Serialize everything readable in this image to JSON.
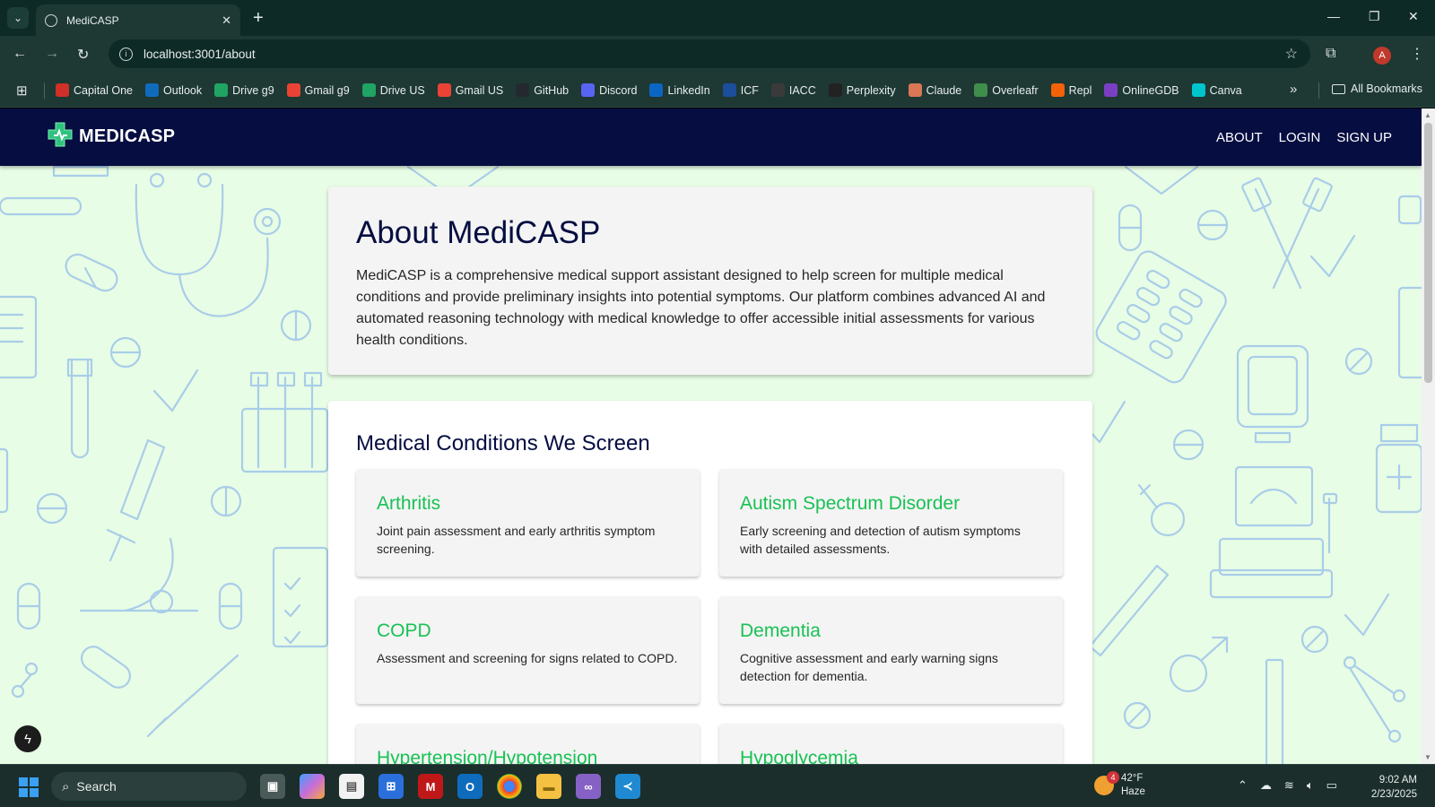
{
  "browser": {
    "tab_title": "MediCASP",
    "url": "localhost:3001/about",
    "profile_initial": "A",
    "bookmarks": [
      {
        "label": "Capital One",
        "color": "#d03027"
      },
      {
        "label": "Outlook",
        "color": "#0f6cbd"
      },
      {
        "label": "Drive g9",
        "color": "#1fa463"
      },
      {
        "label": "Gmail g9",
        "color": "#ea4335"
      },
      {
        "label": "Drive US",
        "color": "#1fa463"
      },
      {
        "label": "Gmail US",
        "color": "#ea4335"
      },
      {
        "label": "GitHub",
        "color": "#24292f"
      },
      {
        "label": "Discord",
        "color": "#5865f2"
      },
      {
        "label": "LinkedIn",
        "color": "#0a66c2"
      },
      {
        "label": "ICF",
        "color": "#1b4f9c"
      },
      {
        "label": "IACC",
        "color": "#3a3a3a"
      },
      {
        "label": "Perplexity",
        "color": "#222222"
      },
      {
        "label": "Claude",
        "color": "#d97757"
      },
      {
        "label": "Overleafr",
        "color": "#3f8f4a"
      },
      {
        "label": "Repl",
        "color": "#f26207"
      },
      {
        "label": "OnlineGDB",
        "color": "#7b3fc4"
      },
      {
        "label": "Canva",
        "color": "#00c4cc"
      }
    ],
    "all_bookmarks_label": "All Bookmarks"
  },
  "site": {
    "brand": "MEDICASP",
    "nav": [
      "ABOUT",
      "LOGIN",
      "SIGN UP"
    ],
    "about": {
      "title": "About MediCASP",
      "body": "MediCASP is a comprehensive medical support assistant designed to help screen for multiple medical conditions and provide preliminary insights into potential symptoms. Our platform combines advanced AI and automated reasoning technology with medical knowledge to offer accessible initial assessments for various health conditions."
    },
    "conditions": {
      "title": "Medical Conditions We Screen",
      "items": [
        {
          "name": "Arthritis",
          "desc": "Joint pain assessment and early arthritis symptom screening."
        },
        {
          "name": "Autism Spectrum Disorder",
          "desc": "Early screening and detection of autism symptoms with detailed assessments."
        },
        {
          "name": "COPD",
          "desc": "Assessment and screening for signs related to COPD."
        },
        {
          "name": "Dementia",
          "desc": "Cognitive assessment and early warning signs detection for dementia."
        },
        {
          "name": "Hypertension/Hypotension",
          "desc": ""
        },
        {
          "name": "Hypoglycemia",
          "desc": ""
        }
      ]
    },
    "colors": {
      "navy": "#050d41",
      "accent_green": "#19c155",
      "pattern_bg": "#e8fde5",
      "pattern_line": "#a9cde9"
    }
  },
  "taskbar": {
    "search_label": "Search",
    "weather": {
      "temp": "42°F",
      "condition": "Haze",
      "badge": "4"
    },
    "time": "9:02 AM",
    "date": "2/23/2025"
  }
}
